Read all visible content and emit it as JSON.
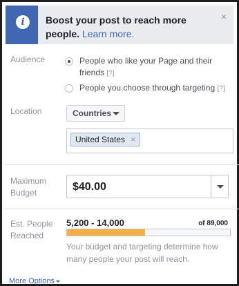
{
  "banner": {
    "title": "Boost your post to reach more people.",
    "link": "Learn more.",
    "info_icon": "info-icon",
    "close_glyph": "×",
    "accent_color": "#4267b2"
  },
  "audience": {
    "label": "Audience",
    "options": [
      {
        "text": "People who like your Page and their friends",
        "help": "[?]",
        "selected": true
      },
      {
        "text": "People you choose through targeting",
        "help": "[?]",
        "selected": false
      }
    ]
  },
  "location": {
    "label": "Location",
    "dropdown_value": "Countries",
    "tokens": [
      {
        "text": "United States",
        "remove": "×"
      }
    ]
  },
  "budget": {
    "label": "Maximum Budget",
    "value": "$40.00"
  },
  "reach": {
    "label": "Est. People Reached",
    "range": "5,200 - 14,000",
    "total": "of 89,000",
    "fill_fraction": 0.48,
    "fill_color": "#f7b044",
    "note": "Your budget and targeting determine how many people your post will reach."
  },
  "footer": {
    "more_options": "More Options"
  }
}
